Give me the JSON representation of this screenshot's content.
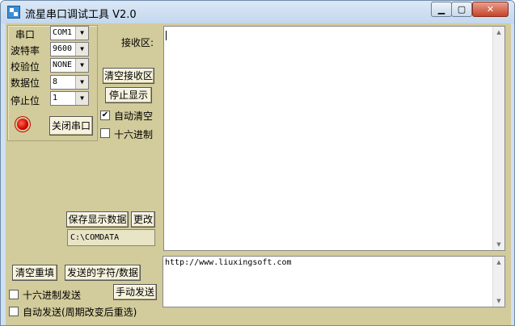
{
  "window": {
    "title": "流星串口调试工具 V2.0",
    "buttons": {
      "minimize": "▁",
      "maximize": "▢",
      "close": "✕"
    }
  },
  "port_settings": {
    "port_label": "串口",
    "port_value": "COM1",
    "baud_label": "波特率",
    "baud_value": "9600",
    "parity_label": "校验位",
    "parity_value": "NONE",
    "databits_label": "数据位",
    "databits_value": "8",
    "stopbits_label": "停止位",
    "stopbits_value": "1",
    "close_port_button": "关闭串口",
    "port_status": "open",
    "status_color": "#d40000"
  },
  "receive": {
    "label": "接收区:",
    "clear_button": "清空接收区",
    "stop_display_button": "停止显示",
    "auto_clear_label": "自动清空",
    "auto_clear_checked": true,
    "hex_label": "十六进制",
    "hex_checked": false,
    "save_button": "保存显示数据",
    "change_button": "更改",
    "save_path": "C:\\COMDATA",
    "content": ""
  },
  "send": {
    "clear_refill_button": "清空重填",
    "send_data_button": "发送的字符/数据",
    "hex_send_label": "十六进制发送",
    "hex_send_checked": false,
    "manual_send_button": "手动发送",
    "auto_send_label": "自动发送(周期改变后重选)",
    "auto_send_checked": false,
    "content": "http://www.liuxingsoft.com"
  },
  "colors": {
    "client_bg": "#d2cb9b",
    "titlebar": "#cfe0f3",
    "close_button": "#c7432a"
  }
}
